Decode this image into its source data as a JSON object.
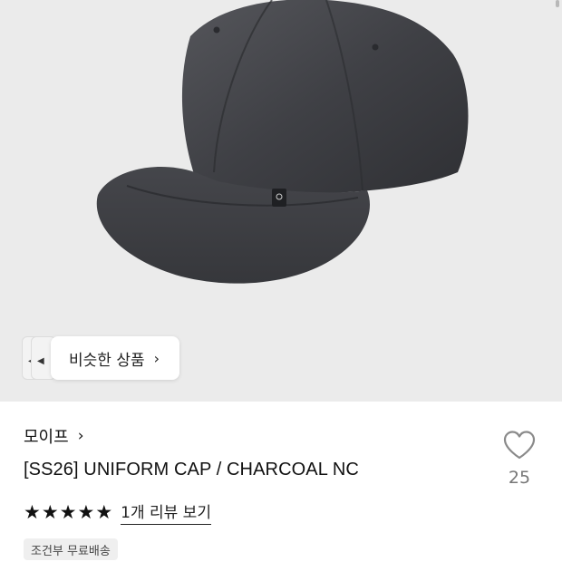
{
  "hero": {
    "image_alt": "charcoal nylon six-panel cap",
    "similar_button_label": "비슷한 상품",
    "similar_chevron": "›"
  },
  "product": {
    "brand": "모이프",
    "brand_chevron": "›",
    "title": "[SS26] UNIFORM CAP / CHARCOAL NC",
    "rating_stars": 5,
    "review_link": "1개 리뷰 보기",
    "like_count": "25",
    "shipping_badge": "조건부 무료배송"
  },
  "icons": {
    "heart": "heart-outline-icon",
    "star": "star-filled-icon",
    "chevron": "chevron-right-icon"
  },
  "colors": {
    "hero_bg": "#ebebeb",
    "cap": "#3b3c40",
    "text": "#111111",
    "muted": "#777777",
    "badge_bg": "#efefef"
  }
}
